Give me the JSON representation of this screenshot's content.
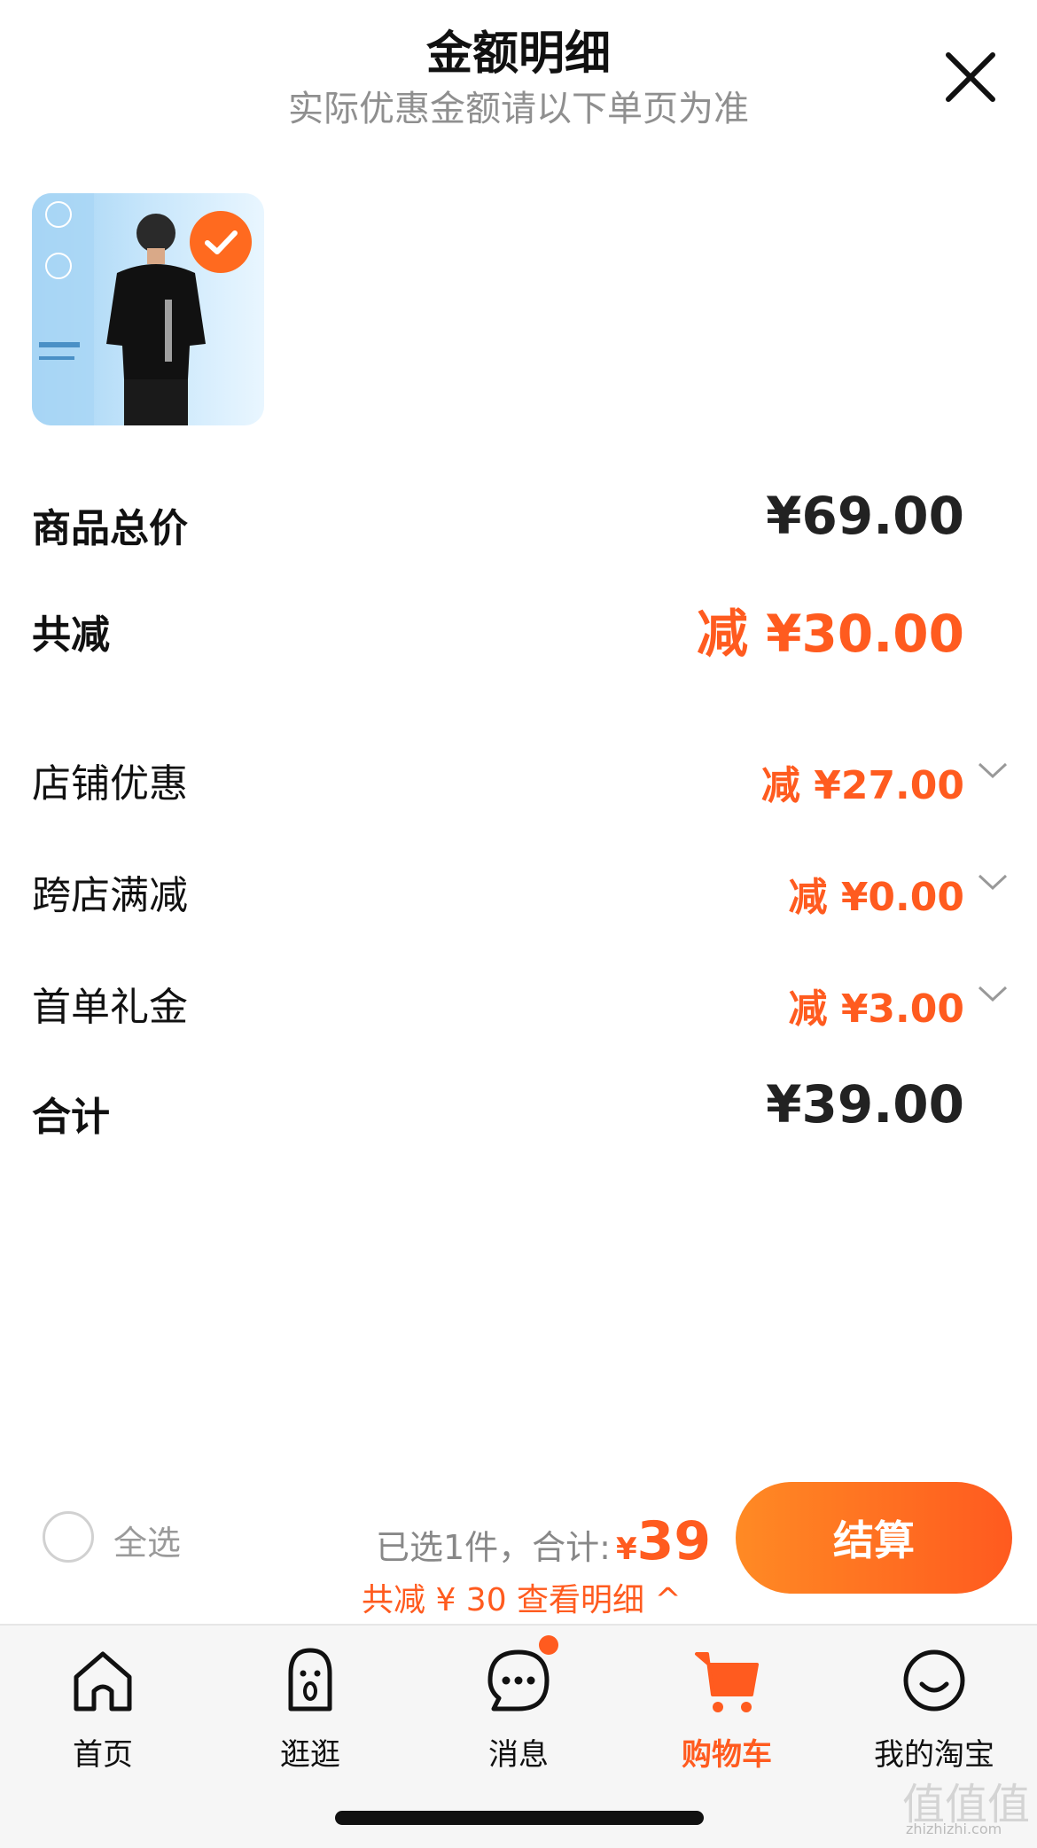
{
  "header": {
    "title": "金额明细",
    "subtitle": "实际优惠金额请以下单页为准"
  },
  "rows": [
    {
      "label": "商品总价",
      "value": "¥69.00"
    },
    {
      "label": "共减",
      "value": "减 ¥30.00"
    },
    {
      "label": "店铺优惠",
      "value": "减 ¥27.00"
    },
    {
      "label": "跨店满减",
      "value": "减 ¥0.00"
    },
    {
      "label": "首单礼金",
      "value": "减 ¥3.00"
    },
    {
      "label": "合计",
      "value": "¥39.00"
    }
  ],
  "bottom": {
    "select_all": "全选",
    "selected_text": "已选1件，合计:",
    "currency": "¥",
    "total": "39",
    "discount_line": "共减 ¥ 30  查看明细 ^",
    "checkout": "结算"
  },
  "tabs": [
    {
      "label": "首页",
      "icon": "home-icon"
    },
    {
      "label": "逛逛",
      "icon": "browse-icon"
    },
    {
      "label": "消息",
      "icon": "message-icon"
    },
    {
      "label": "购物车",
      "icon": "cart-icon"
    },
    {
      "label": "我的淘宝",
      "icon": "profile-icon"
    }
  ],
  "watermark": {
    "mark": "值值值",
    "url": "zhizhizhi.com"
  },
  "colors": {
    "accent": "#ff5b1f",
    "text": "#111111",
    "muted": "#8f8f8f"
  }
}
